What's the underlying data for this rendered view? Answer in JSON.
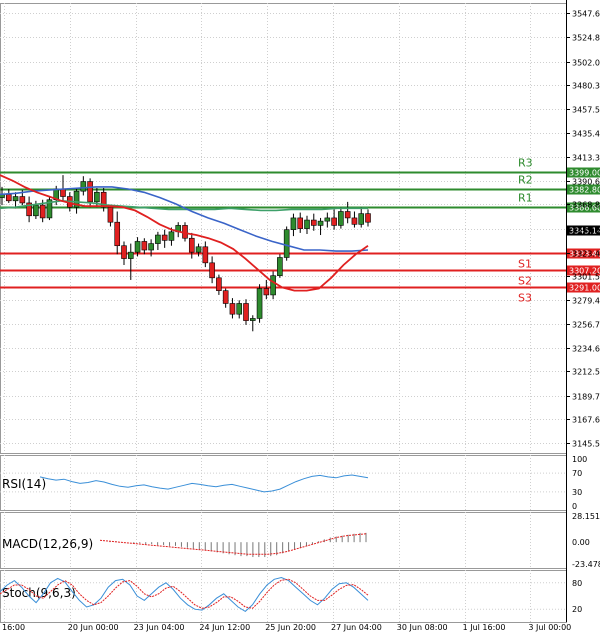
{
  "chart_data": {
    "type": "candlestick",
    "main": {
      "price_ticks": [
        "3547.60",
        "3524.80",
        "3502.05",
        "3480.30",
        "3457.55",
        "3435.40",
        "3413.35",
        "3390.60",
        "3368.85",
        "3345.90",
        "3323.40",
        "3301.55",
        "3279.45",
        "3256.70",
        "3234.60",
        "3212.50",
        "3189.75",
        "3167.65",
        "3145.55"
      ],
      "ylim": [
        3145.55,
        3547.6
      ],
      "levels": [
        {
          "name": "R3",
          "value": 3399.0,
          "label": "3399.00",
          "color": "#2e8b2e"
        },
        {
          "name": "R2",
          "value": 3382.8,
          "label": "3382.80",
          "color": "#2e8b2e"
        },
        {
          "name": "R1",
          "value": 3366.6,
          "label": "3366.60",
          "color": "#2e8b2e"
        },
        {
          "name": "S1",
          "value": 3323.4,
          "label": "3323.40",
          "color": "#e02020"
        },
        {
          "name": "S2",
          "value": 3307.2,
          "label": "3307.20",
          "color": "#e02020"
        },
        {
          "name": "S3",
          "value": 3291.0,
          "label": "3291.00",
          "color": "#e02020"
        }
      ],
      "current_price": {
        "value": 3345.14,
        "label": "3345.14"
      },
      "candles": [
        [
          3375,
          3385,
          3368,
          3378
        ],
        [
          3378,
          3383,
          3370,
          3372
        ],
        [
          3372,
          3380,
          3365,
          3376
        ],
        [
          3376,
          3382,
          3368,
          3370
        ],
        [
          3370,
          3376,
          3352,
          3358
        ],
        [
          3358,
          3372,
          3355,
          3368
        ],
        [
          3368,
          3373,
          3352,
          3356
        ],
        [
          3356,
          3376,
          3354,
          3373
        ],
        [
          3373,
          3386,
          3368,
          3383
        ],
        [
          3383,
          3396,
          3372,
          3376
        ],
        [
          3376,
          3380,
          3362,
          3366
        ],
        [
          3366,
          3384,
          3360,
          3381
        ],
        [
          3381,
          3395,
          3377,
          3390
        ],
        [
          3390,
          3393,
          3366,
          3371
        ],
        [
          3371,
          3384,
          3366,
          3380
        ],
        [
          3380,
          3384,
          3362,
          3366
        ],
        [
          3366,
          3368,
          3348,
          3352
        ],
        [
          3352,
          3362,
          3322,
          3330
        ],
        [
          3330,
          3334,
          3312,
          3318
        ],
        [
          3318,
          3332,
          3298,
          3324
        ],
        [
          3324,
          3338,
          3320,
          3334
        ],
        [
          3334,
          3337,
          3322,
          3326
        ],
        [
          3326,
          3336,
          3320,
          3332
        ],
        [
          3332,
          3343,
          3326,
          3340
        ],
        [
          3340,
          3345,
          3328,
          3335
        ],
        [
          3335,
          3347,
          3330,
          3343
        ],
        [
          3343,
          3352,
          3338,
          3349
        ],
        [
          3349,
          3352,
          3334,
          3337
        ],
        [
          3337,
          3342,
          3318,
          3324
        ],
        [
          3324,
          3332,
          3320,
          3329
        ],
        [
          3329,
          3334,
          3310,
          3314
        ],
        [
          3314,
          3320,
          3295,
          3300
        ],
        [
          3300,
          3303,
          3284,
          3288
        ],
        [
          3288,
          3290,
          3272,
          3276
        ],
        [
          3276,
          3281,
          3262,
          3266
        ],
        [
          3266,
          3279,
          3262,
          3276
        ],
        [
          3276,
          3280,
          3256,
          3260
        ],
        [
          3260,
          3265,
          3250,
          3262
        ],
        [
          3262,
          3294,
          3258,
          3290
        ],
        [
          3290,
          3298,
          3280,
          3284
        ],
        [
          3284,
          3306,
          3280,
          3302
        ],
        [
          3302,
          3322,
          3300,
          3319
        ],
        [
          3319,
          3348,
          3316,
          3345
        ],
        [
          3345,
          3360,
          3339,
          3356
        ],
        [
          3356,
          3361,
          3342,
          3346
        ],
        [
          3346,
          3358,
          3341,
          3354
        ],
        [
          3354,
          3360,
          3344,
          3349
        ],
        [
          3349,
          3356,
          3340,
          3353
        ],
        [
          3353,
          3361,
          3347,
          3356
        ],
        [
          3356,
          3364,
          3345,
          3349
        ],
        [
          3349,
          3366,
          3346,
          3362
        ],
        [
          3362,
          3371,
          3351,
          3356
        ],
        [
          3356,
          3362,
          3347,
          3350
        ],
        [
          3350,
          3366,
          3347,
          3360
        ],
        [
          3360,
          3364,
          3348,
          3352
        ]
      ],
      "ma_red": [
        3396,
        3391,
        3385,
        3380,
        3376,
        3372,
        3369,
        3367,
        3367,
        3367,
        3366,
        3363,
        3357,
        3350,
        3345,
        3342,
        3340,
        3337,
        3333,
        3327,
        3318,
        3308,
        3298,
        3291,
        3288,
        3288,
        3290,
        3300,
        3312,
        3322,
        3330
      ],
      "ma_blue": [
        3378,
        3379,
        3381,
        3382,
        3383,
        3384,
        3385,
        3385,
        3383,
        3380,
        3375,
        3369,
        3362,
        3356,
        3351,
        3345,
        3339,
        3334,
        3330,
        3326,
        3326,
        3325,
        3325,
        3326
      ],
      "ma_green": [
        3365,
        3366,
        3368,
        3370,
        3372,
        3371,
        3370,
        3368,
        3367,
        3366,
        3365,
        3364,
        3364,
        3364,
        3364,
        3365,
        3364,
        3363,
        3363,
        3364,
        3364,
        3364,
        3365,
        3365,
        3365
      ]
    },
    "x_ticks": [
      "16:00",
      "20 Jun 00:00",
      "23 Jun 04:00",
      "24 Jun 12:00",
      "25 Jun 20:00",
      "27 Jun 04:00",
      "30 Jun 08:00",
      "1 Jul 16:00",
      "3 Jul 00:00"
    ],
    "rsi": {
      "name": "RSI(14)",
      "ticks": [
        "100",
        "70",
        "30",
        "0"
      ],
      "ylim": [
        0,
        100
      ],
      "values": [
        62,
        58,
        55,
        57,
        52,
        48,
        50,
        54,
        51,
        46,
        42,
        40,
        43,
        45,
        41,
        38,
        36,
        40,
        44,
        48,
        46,
        43,
        41,
        44,
        46,
        42,
        38,
        34,
        30,
        32,
        36,
        44,
        52,
        58,
        63,
        65,
        62,
        60,
        64,
        66,
        63,
        60
      ]
    },
    "macd": {
      "name": "MACD(12,26,9)",
      "ticks": [
        "28.151",
        "0.00",
        "-23.478"
      ],
      "ylim": [
        -23.478,
        28.151
      ],
      "histogram": [
        1,
        1,
        0,
        0,
        -1,
        -1,
        -2,
        -2,
        -3,
        -3,
        -4,
        -4,
        -5,
        -6,
        -7,
        -8,
        -9,
        -10,
        -11,
        -12,
        -13,
        -14,
        -15,
        -15,
        -16,
        -16,
        -16,
        -15,
        -14,
        -12,
        -10,
        -8,
        -6,
        -4,
        -2,
        1,
        3,
        5,
        6,
        7,
        8,
        9,
        10,
        10
      ],
      "signal": [
        2,
        1,
        0,
        -1,
        -2,
        -3,
        -4,
        -5,
        -6,
        -7,
        -8,
        -9,
        -10,
        -11,
        -12,
        -13,
        -13,
        -13,
        -12,
        -10,
        -7,
        -4,
        -1,
        2,
        5,
        7,
        8,
        9
      ]
    },
    "stoch": {
      "name": "Stoch(9,6,3)",
      "ticks": [
        "80",
        "20"
      ],
      "ylim": [
        0,
        100
      ],
      "k": [
        60,
        75,
        85,
        70,
        50,
        35,
        55,
        80,
        90,
        82,
        60,
        40,
        25,
        30,
        45,
        70,
        85,
        88,
        75,
        50,
        40,
        55,
        70,
        80,
        65,
        45,
        30,
        20,
        18,
        30,
        45,
        55,
        40,
        25,
        15,
        30,
        55,
        75,
        88,
        92,
        85,
        70,
        55,
        40,
        30,
        45,
        65,
        78,
        80,
        70,
        55,
        40
      ],
      "d": [
        55,
        65,
        75,
        75,
        65,
        50,
        45,
        60,
        75,
        85,
        75,
        55,
        40,
        30,
        35,
        50,
        68,
        82,
        85,
        72,
        55,
        48,
        55,
        68,
        72,
        60,
        45,
        30,
        22,
        25,
        35,
        48,
        48,
        38,
        25,
        22,
        38,
        58,
        75,
        86,
        88,
        80,
        65,
        50,
        40,
        40,
        52,
        65,
        74,
        76,
        65,
        52
      ]
    },
    "colors": {
      "bull": "#2e8b2e",
      "bear": "#e02020",
      "wick": "#000000",
      "ma_red": "#e02020",
      "ma_blue": "#3a64c8",
      "ma_green": "#3ea06a",
      "osc": "#3a8fd8",
      "signal": "#e02020",
      "cur_price_bg": "#000000"
    }
  }
}
